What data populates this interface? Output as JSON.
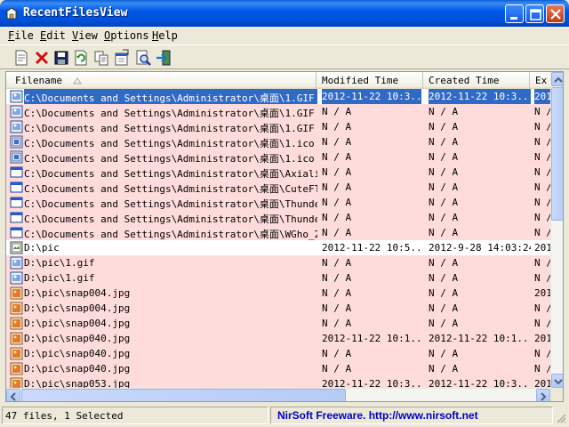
{
  "window": {
    "title": "RecentFilesView"
  },
  "menu": [
    {
      "pre": "",
      "key": "F",
      "post": "ile"
    },
    {
      "pre": "",
      "key": "E",
      "post": "dit"
    },
    {
      "pre": "",
      "key": "V",
      "post": "iew"
    },
    {
      "pre": "",
      "key": "O",
      "post": "ptions"
    },
    {
      "pre": "",
      "key": "H",
      "post": "elp"
    }
  ],
  "toolbar": {
    "icons": [
      "properties-icon",
      "delete-icon",
      "save-icon",
      "refresh-icon",
      "copy-icon",
      "html-report-icon",
      "find-icon",
      "exit-icon"
    ]
  },
  "table": {
    "columns": [
      "Filename",
      "Modified Time",
      "Created Time",
      "Ex"
    ],
    "rows": [
      {
        "icon": "gif",
        "name": "C:\\Documents and Settings\\Administrator\\桌面\\1.GIF",
        "modified": "2012-11-22 10:3...",
        "created": "2012-11-22 10:3...",
        "ext": "201",
        "style": "sel"
      },
      {
        "icon": "gif",
        "name": "C:\\Documents and Settings\\Administrator\\桌面\\1.GIF",
        "modified": "N / A",
        "created": "N / A",
        "ext": "N /",
        "style": "pink"
      },
      {
        "icon": "gif",
        "name": "C:\\Documents and Settings\\Administrator\\桌面\\1.GIF",
        "modified": "N / A",
        "created": "N / A",
        "ext": "N /",
        "style": "pink"
      },
      {
        "icon": "ico",
        "name": "C:\\Documents and Settings\\Administrator\\桌面\\1.ico",
        "modified": "N / A",
        "created": "N / A",
        "ext": "N /",
        "style": "pink"
      },
      {
        "icon": "ico",
        "name": "C:\\Documents and Settings\\Administrator\\桌面\\1.ico",
        "modified": "N / A",
        "created": "N / A",
        "ext": "N /",
        "style": "pink"
      },
      {
        "icon": "app",
        "name": "C:\\Documents and Settings\\Administrator\\桌面\\Axiali...",
        "modified": "N / A",
        "created": "N / A",
        "ext": "N /",
        "style": "pink"
      },
      {
        "icon": "app",
        "name": "C:\\Documents and Settings\\Administrator\\桌面\\CuteFT...",
        "modified": "N / A",
        "created": "N / A",
        "ext": "N /",
        "style": "pink"
      },
      {
        "icon": "app",
        "name": "C:\\Documents and Settings\\Administrator\\桌面\\Thunde...",
        "modified": "N / A",
        "created": "N / A",
        "ext": "N /",
        "style": "pink"
      },
      {
        "icon": "app",
        "name": "C:\\Documents and Settings\\Administrator\\桌面\\Thunde...",
        "modified": "N / A",
        "created": "N / A",
        "ext": "N /",
        "style": "pink"
      },
      {
        "icon": "app",
        "name": "C:\\Documents and Settings\\Administrator\\桌面\\WGho_2...",
        "modified": "N / A",
        "created": "N / A",
        "ext": "N /",
        "style": "pink"
      },
      {
        "icon": "folder",
        "name": "D:\\pic",
        "modified": "2012-11-22 10:5...",
        "created": "2012-9-28 14:03:24",
        "ext": "201",
        "style": "white"
      },
      {
        "icon": "gif",
        "name": "D:\\pic\\1.gif",
        "modified": "N / A",
        "created": "N / A",
        "ext": "N /",
        "style": "pink"
      },
      {
        "icon": "gif",
        "name": "D:\\pic\\1.gif",
        "modified": "N / A",
        "created": "N / A",
        "ext": "N /",
        "style": "pink"
      },
      {
        "icon": "jpg",
        "name": "D:\\pic\\snap004.jpg",
        "modified": "N / A",
        "created": "N / A",
        "ext": "201",
        "style": "pink"
      },
      {
        "icon": "jpg",
        "name": "D:\\pic\\snap004.jpg",
        "modified": "N / A",
        "created": "N / A",
        "ext": "N /",
        "style": "pink"
      },
      {
        "icon": "jpg",
        "name": "D:\\pic\\snap004.jpg",
        "modified": "N / A",
        "created": "N / A",
        "ext": "N /",
        "style": "pink"
      },
      {
        "icon": "jpg",
        "name": "D:\\pic\\snap040.jpg",
        "modified": "2012-11-22 10:1...",
        "created": "2012-11-22 10:1...",
        "ext": "201",
        "style": "pink"
      },
      {
        "icon": "jpg",
        "name": "D:\\pic\\snap040.jpg",
        "modified": "N / A",
        "created": "N / A",
        "ext": "N /",
        "style": "pink"
      },
      {
        "icon": "jpg",
        "name": "D:\\pic\\snap040.jpg",
        "modified": "N / A",
        "created": "N / A",
        "ext": "N /",
        "style": "pink"
      },
      {
        "icon": "jpg",
        "name": "D:\\pic\\snap053.jpg",
        "modified": "2012-11-22 10:3...",
        "created": "2012-11-22 10:3...",
        "ext": "201",
        "style": "pink"
      }
    ]
  },
  "status": {
    "left": "47 files, 1 Selected",
    "right": "NirSoft Freeware.  http://www.nirsoft.net"
  },
  "colors": {
    "title_bar": "#0054e3",
    "selection": "#316ac5",
    "row_pink": "#ffdcdc",
    "link_text": "#0000c8"
  }
}
